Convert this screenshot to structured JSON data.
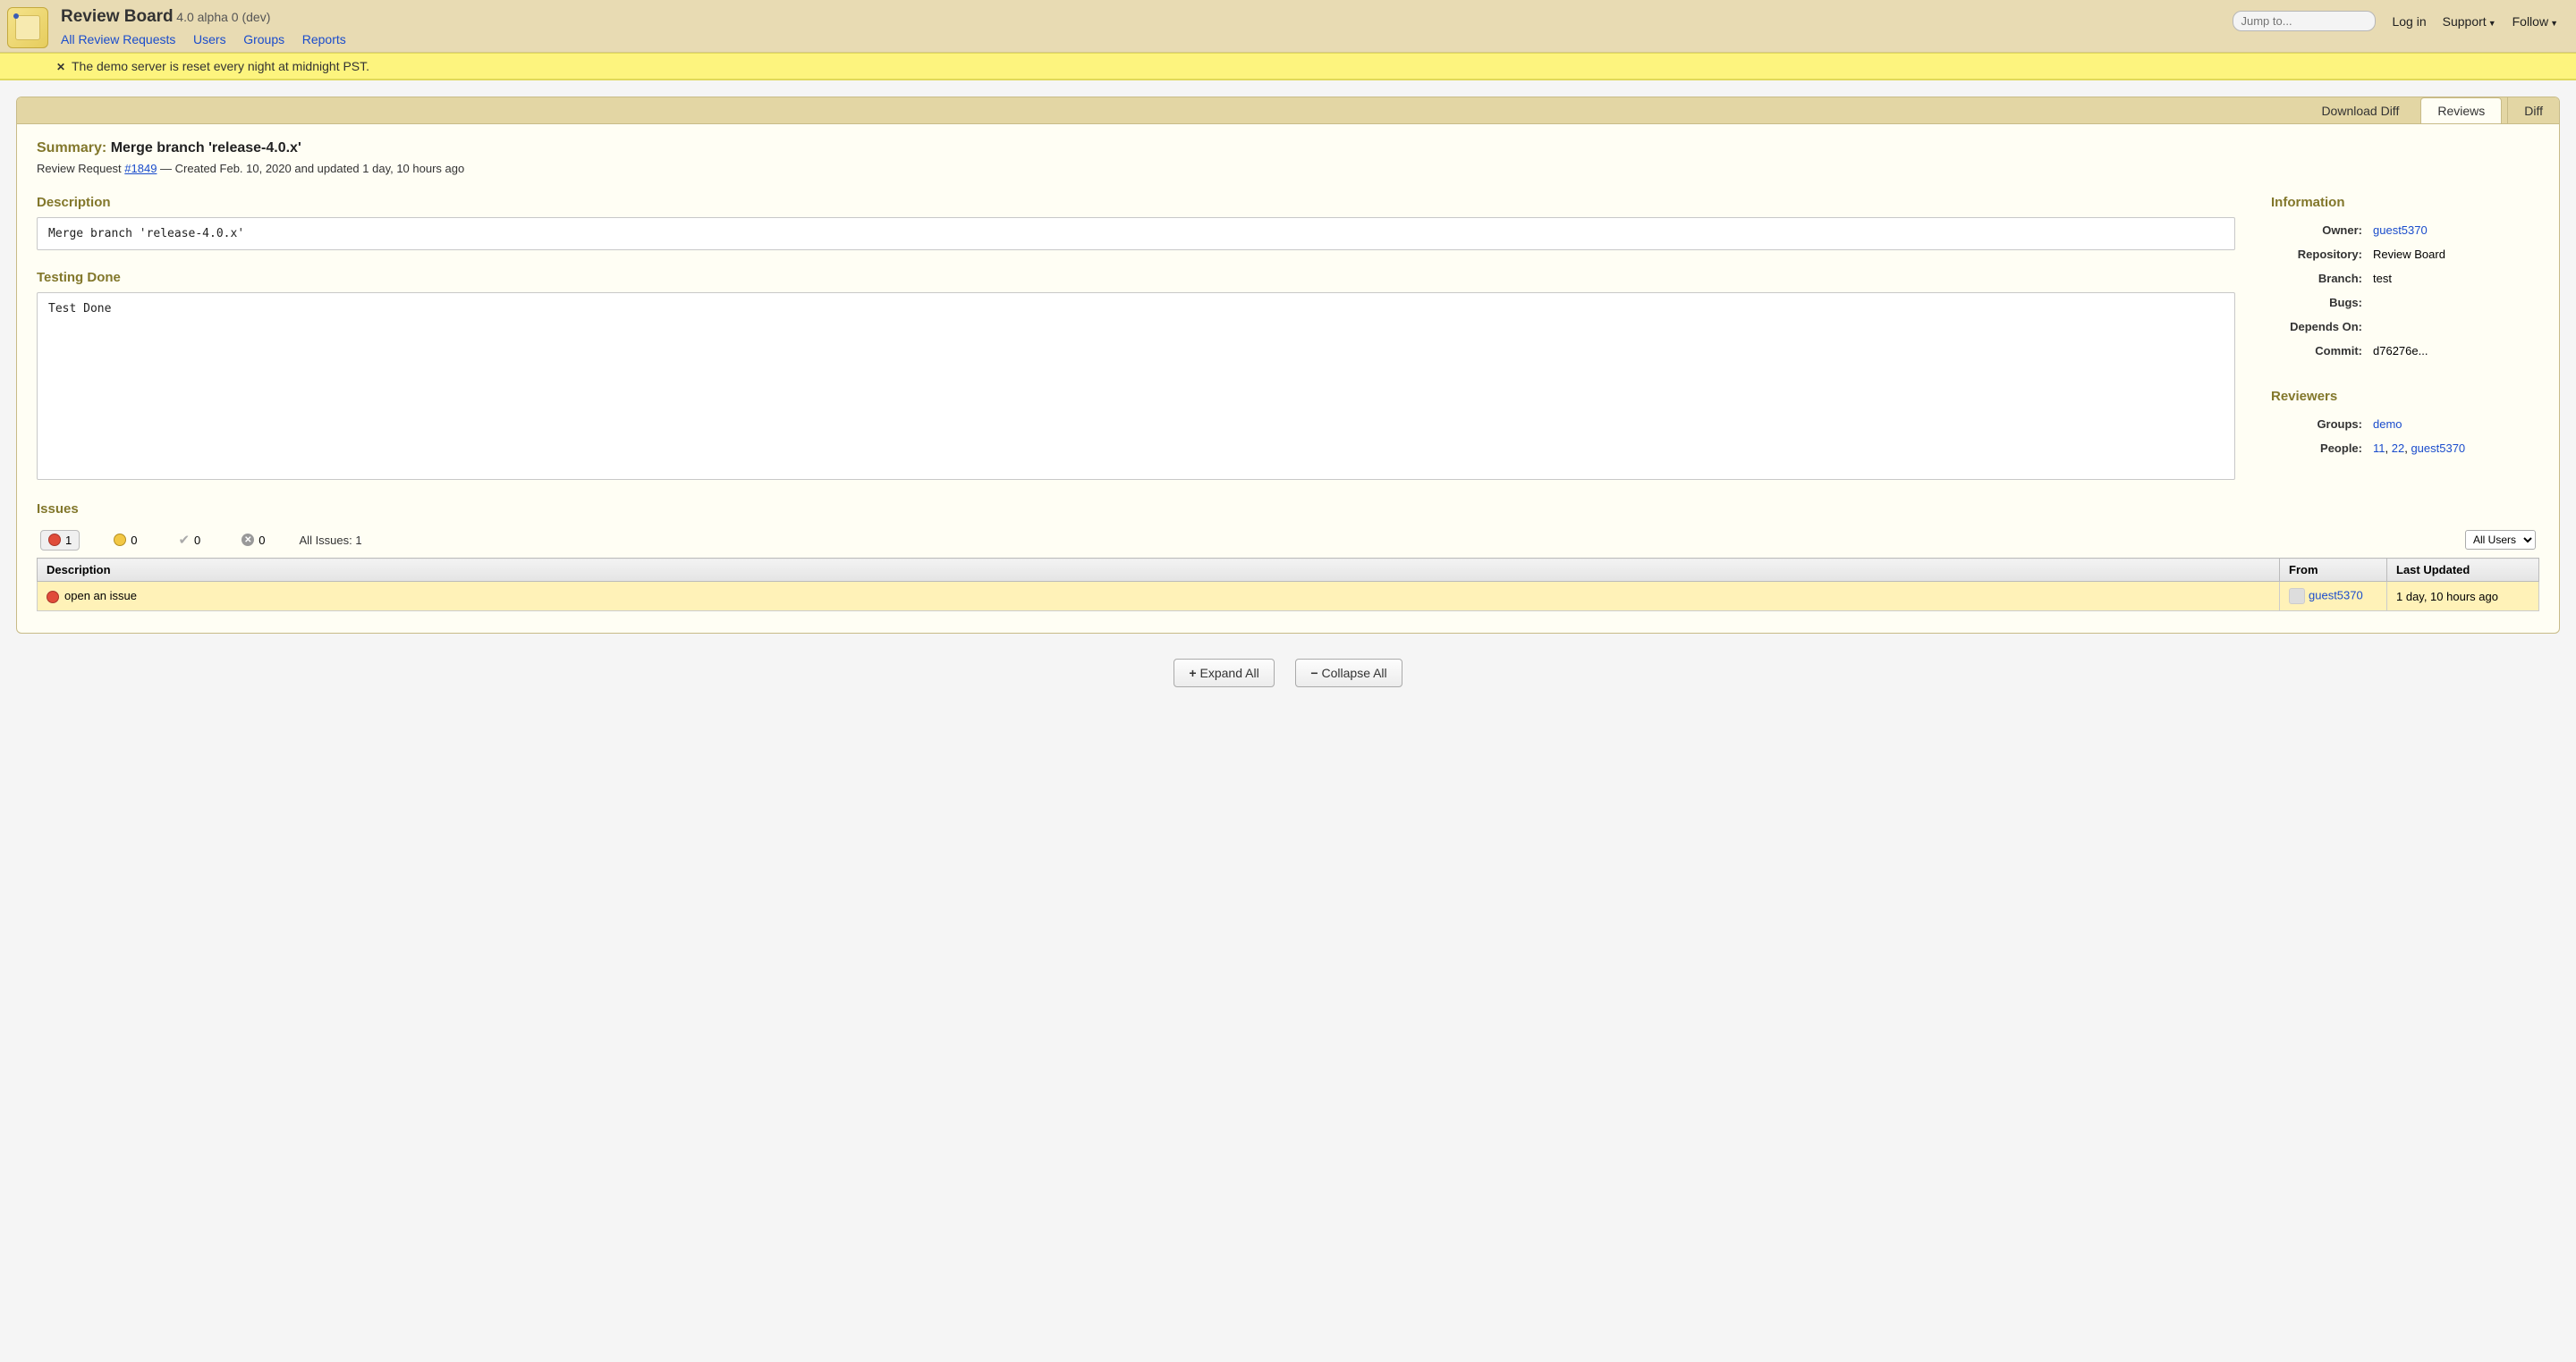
{
  "header": {
    "brand": "Review Board",
    "version": "4.0 alpha 0 (dev)",
    "nav": {
      "all": "All Review Requests",
      "users": "Users",
      "groups": "Groups",
      "reports": "Reports"
    },
    "jump_placeholder": "Jump to...",
    "login": "Log in",
    "support": "Support",
    "follow": "Follow"
  },
  "banner": {
    "text": "The demo server is reset every night at midnight PST."
  },
  "tabs": {
    "download": "Download Diff",
    "reviews": "Reviews",
    "diff": "Diff"
  },
  "summary": {
    "label": "Summary:",
    "text": "Merge branch 'release-4.0.x'",
    "meta_prefix": "Review Request ",
    "req_id": "#1849",
    "meta_suffix": " — Created Feb. 10, 2020 and updated 1 day, 10 hours ago"
  },
  "description": {
    "heading": "Description",
    "content": "Merge branch 'release-4.0.x'"
  },
  "testing": {
    "heading": "Testing Done",
    "content": "Test Done"
  },
  "info": {
    "heading": "Information",
    "owner_k": "Owner:",
    "owner_v": "guest5370",
    "repo_k": "Repository:",
    "repo_v": "Review Board",
    "branch_k": "Branch:",
    "branch_v": "test",
    "bugs_k": "Bugs:",
    "bugs_v": "",
    "depends_k": "Depends On:",
    "depends_v": "",
    "commit_k": "Commit:",
    "commit_v": "d76276e..."
  },
  "reviewers": {
    "heading": "Reviewers",
    "groups_k": "Groups:",
    "groups_v": "demo",
    "people_k": "People:",
    "people": {
      "p1": "11",
      "p2": "22",
      "p3": "guest5370"
    }
  },
  "issues": {
    "heading": "Issues",
    "open_count": "1",
    "pending_count": "0",
    "resolved_count": "0",
    "dropped_count": "0",
    "all_label": "All Issues: 1",
    "filter": "All Users",
    "th_desc": "Description",
    "th_from": "From",
    "th_updated": "Last Updated",
    "row": {
      "desc": "open an issue",
      "from": "guest5370",
      "updated": "1 day, 10 hours ago"
    }
  },
  "footer": {
    "expand": "Expand All",
    "collapse": "Collapse All"
  }
}
